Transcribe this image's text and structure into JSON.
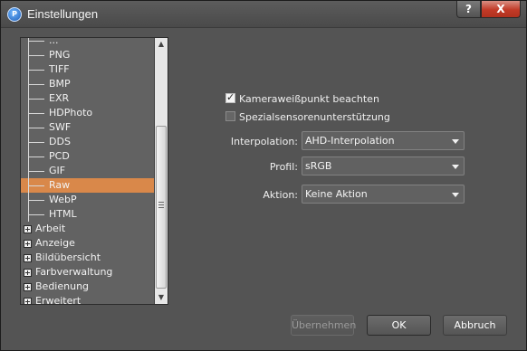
{
  "window": {
    "title": "Einstellungen",
    "icon": "app-logo-icon",
    "icon_text": "P",
    "help_label": "?",
    "close_label": "X"
  },
  "tree": {
    "items": [
      {
        "label": "...",
        "type": "child",
        "selected": false
      },
      {
        "label": "PNG",
        "type": "child",
        "selected": false
      },
      {
        "label": "TIFF",
        "type": "child",
        "selected": false
      },
      {
        "label": "BMP",
        "type": "child",
        "selected": false
      },
      {
        "label": "EXR",
        "type": "child",
        "selected": false
      },
      {
        "label": "HDPhoto",
        "type": "child",
        "selected": false
      },
      {
        "label": "SWF",
        "type": "child",
        "selected": false
      },
      {
        "label": "DDS",
        "type": "child",
        "selected": false
      },
      {
        "label": "PCD",
        "type": "child",
        "selected": false
      },
      {
        "label": "GIF",
        "type": "child",
        "selected": false
      },
      {
        "label": "Raw",
        "type": "child",
        "selected": true
      },
      {
        "label": "WebP",
        "type": "child",
        "selected": false
      },
      {
        "label": "HTML",
        "type": "child",
        "selected": false
      },
      {
        "label": "Arbeit",
        "type": "parent",
        "selected": false
      },
      {
        "label": "Anzeige",
        "type": "parent",
        "selected": false
      },
      {
        "label": "Bildübersicht",
        "type": "parent",
        "selected": false
      },
      {
        "label": "Farbverwaltung",
        "type": "parent",
        "selected": false
      },
      {
        "label": "Bedienung",
        "type": "parent",
        "selected": false
      },
      {
        "label": "Erweitert",
        "type": "parent",
        "selected": false
      }
    ]
  },
  "settings": {
    "camera_wb": {
      "label": "Kameraweißpunkt beachten",
      "checked": true
    },
    "special_sensor": {
      "label": "Spezialsensorenunterstützung",
      "checked": false
    },
    "interpolation": {
      "label": "Interpolation:",
      "value": "AHD-Interpolation"
    },
    "profile": {
      "label": "Profil:",
      "value": "sRGB"
    },
    "action": {
      "label": "Aktion:",
      "value": "Keine Aktion"
    }
  },
  "buttons": {
    "apply": "Übernehmen",
    "ok": "OK",
    "cancel": "Abbruch"
  },
  "colors": {
    "background": "#545454",
    "selection": "#d9884a",
    "close": "#c23a27"
  }
}
